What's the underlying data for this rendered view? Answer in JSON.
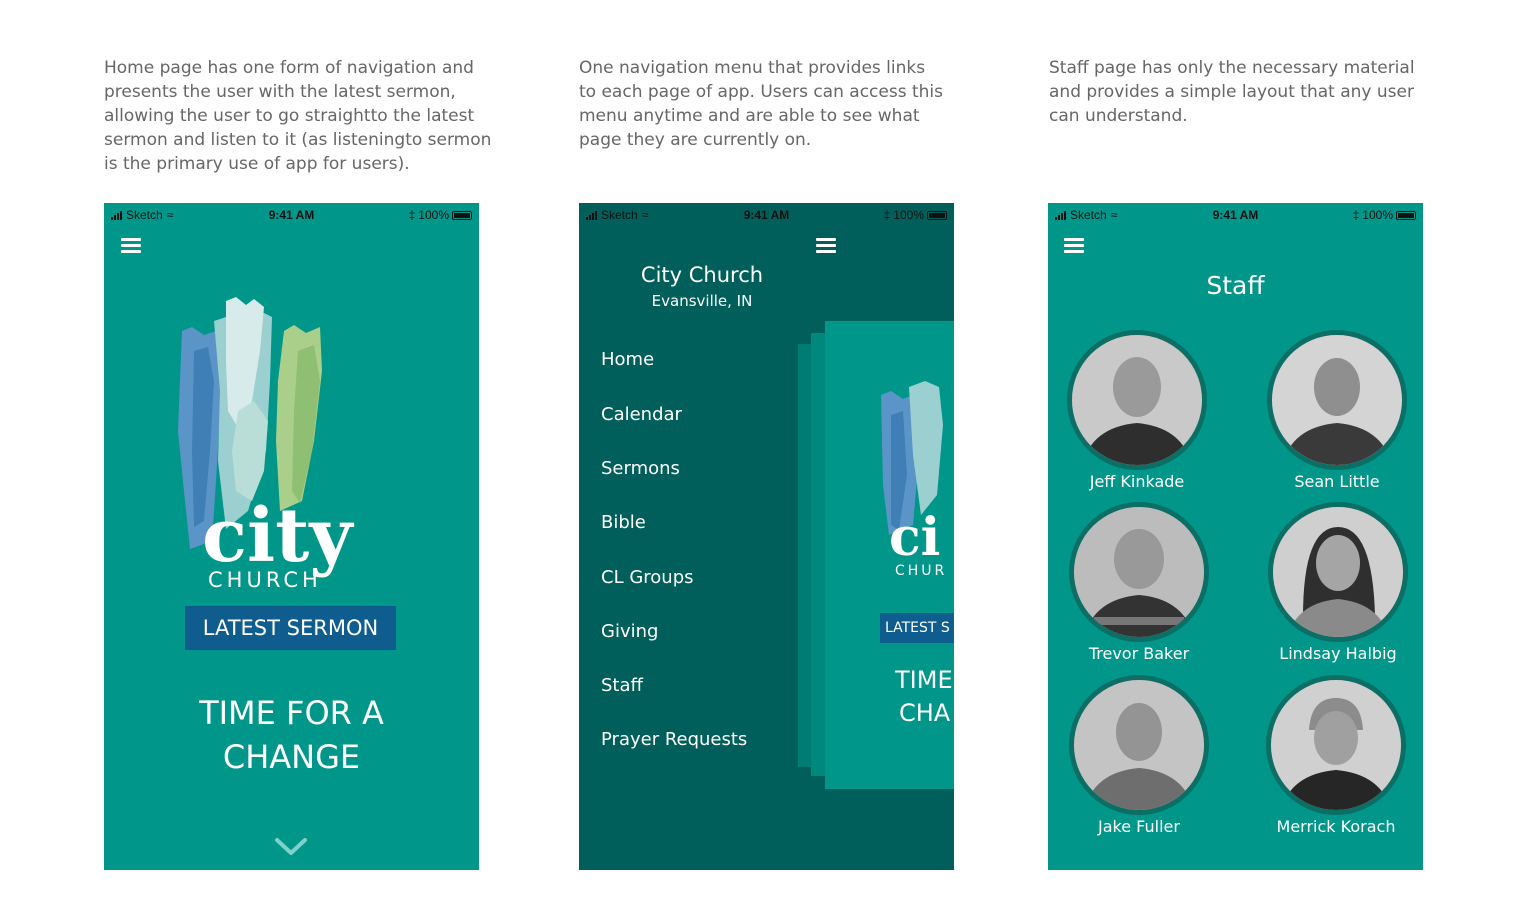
{
  "captions": [
    "Home page has one form of navigation and presents the user with the latest sermon, allowing the user to go straightto the latest sermon and listen to it (as listeningto sermon is the primary use of app for users).",
    "One navigation menu that provides links to each page of app. Users can access this menu anytime and are able to see what page they are currently on.",
    "Staff page has only the necessary material and provides a simple layout that any user can understand."
  ],
  "status_bar": {
    "carrier": "Sketch",
    "time": "9:41 AM",
    "battery": "100%"
  },
  "colors": {
    "teal": "#00978a",
    "dark_teal": "#005f5b",
    "button_blue": "#0e5d8e",
    "avatar_ring": "#0b6f66"
  },
  "home": {
    "logo_word": "city",
    "logo_sub": "CHURCH",
    "latest_button": "LATEST SERMON",
    "headline_line1": "TIME FOR A",
    "headline_line2": "CHANGE",
    "scroll_icon": "chevron-down-icon"
  },
  "nav": {
    "church_name": "City Church",
    "location": "Evansville, IN",
    "items": [
      "Home",
      "Calendar",
      "Sermons",
      "Bible",
      "CL Groups",
      "Giving",
      "Staff",
      "Prayer Requests"
    ],
    "peek_logo": "ci",
    "peek_logo_sub": "CHUR",
    "peek_button": "LATEST S",
    "peek_headline1": "TIME",
    "peek_headline2": "CHA"
  },
  "staff": {
    "title": "Staff",
    "members": [
      {
        "name": "Jeff Kinkade"
      },
      {
        "name": "Sean Little"
      },
      {
        "name": "Trevor Baker"
      },
      {
        "name": "Lindsay Halbig"
      },
      {
        "name": "Jake Fuller"
      },
      {
        "name": "Merrick Korach"
      }
    ]
  }
}
